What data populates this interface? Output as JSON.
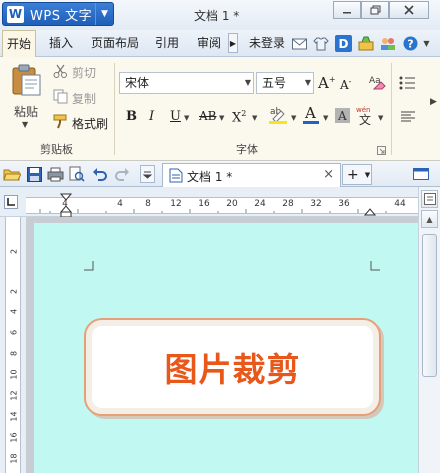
{
  "titlebar": {
    "app_logo": "W",
    "app_name": "WPS 文字",
    "doc_title": "文档 1 *"
  },
  "menu": {
    "tabs": [
      "开始",
      "插入",
      "页面布局",
      "引用",
      "审阅"
    ],
    "login": "未登录"
  },
  "ribbon": {
    "clipboard": {
      "paste_label": "粘贴",
      "cut_label": "剪切",
      "copy_label": "复制",
      "format_painter_label": "格式刷",
      "group_label": "剪贴板"
    },
    "font": {
      "font_name": "宋体",
      "font_size": "五号",
      "grow_label": "A",
      "shrink_label": "A",
      "bold_label": "B",
      "italic_label": "I",
      "underline_label": "U",
      "strike_label": "AB",
      "superscript_label": "X",
      "font_color_label": "A",
      "char_shade_label": "A",
      "phonetic_label": "wén",
      "highlight_label": "ab",
      "group_label": "字体"
    }
  },
  "toolbar": {
    "doc_tab_label": "文档 1 *",
    "close_label": "×",
    "new_tab_label": "+"
  },
  "ruler": {
    "h_labels": [
      "4",
      "4",
      "8",
      "12",
      "16",
      "20",
      "24",
      "28",
      "32",
      "36",
      "44"
    ],
    "v_labels": [
      "2",
      "2",
      "4",
      "6",
      "8",
      "10",
      "12",
      "14",
      "16",
      "18"
    ]
  },
  "document": {
    "text": "图片裁剪"
  },
  "colors": {
    "page_background": "#c2f8f2",
    "text_color": "#e8581b",
    "frame_border": "#e6a079",
    "app_button": "#2a6fcc"
  }
}
